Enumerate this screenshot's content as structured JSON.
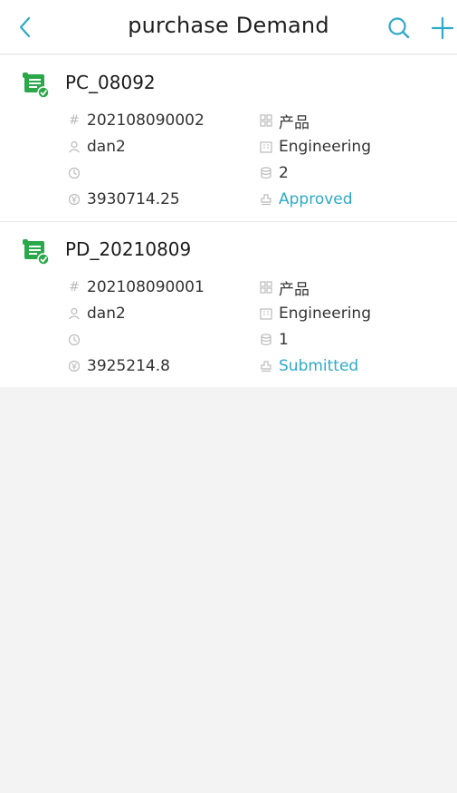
{
  "header": {
    "title": "purchase Demand",
    "accent": "#2ea9c9"
  },
  "records": [
    {
      "title": "PC_08092",
      "number": "202108090002",
      "category": "产品",
      "user": "dan2",
      "department": "Engineering",
      "time": "",
      "quantity": "2",
      "amount": "3930714.25",
      "status": "Approved"
    },
    {
      "title": "PD_20210809",
      "number": "202108090001",
      "category": "产品",
      "user": "dan2",
      "department": "Engineering",
      "time": "",
      "quantity": "1",
      "amount": "3925214.8",
      "status": "Submitted"
    }
  ],
  "icons": {
    "back": "chevron-left-icon",
    "search": "search-icon",
    "add": "plus-icon",
    "record": "document-check-icon",
    "number": "hash-icon",
    "category": "grid-icon",
    "user": "user-icon",
    "department": "building-icon",
    "time": "clock-icon",
    "quantity": "database-icon",
    "amount": "currency-icon",
    "status": "stamp-icon"
  }
}
